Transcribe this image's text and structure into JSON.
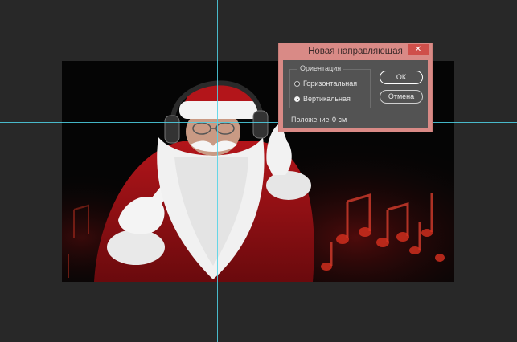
{
  "dialog": {
    "title": "Новая направляющая",
    "close_label": "✕",
    "orientation_group_label": "Ориентация",
    "orientation_options": [
      {
        "label": "Горизонтальная",
        "selected": false
      },
      {
        "label": "Вертикальная",
        "selected": true
      }
    ],
    "ok_label": "ОК",
    "cancel_label": "Отмена",
    "position_label": "Положение:",
    "position_value": "0 см"
  },
  "colors": {
    "workspace_bg": "#282828",
    "guide": "#4fd3e8",
    "dialog_frame": "#d98a86",
    "dialog_body": "#535353",
    "close_button": "#cf4f4a"
  },
  "icons": {
    "close": "close-icon",
    "radio_unselected": "radio-unchecked-icon",
    "radio_selected": "radio-checked-icon"
  }
}
